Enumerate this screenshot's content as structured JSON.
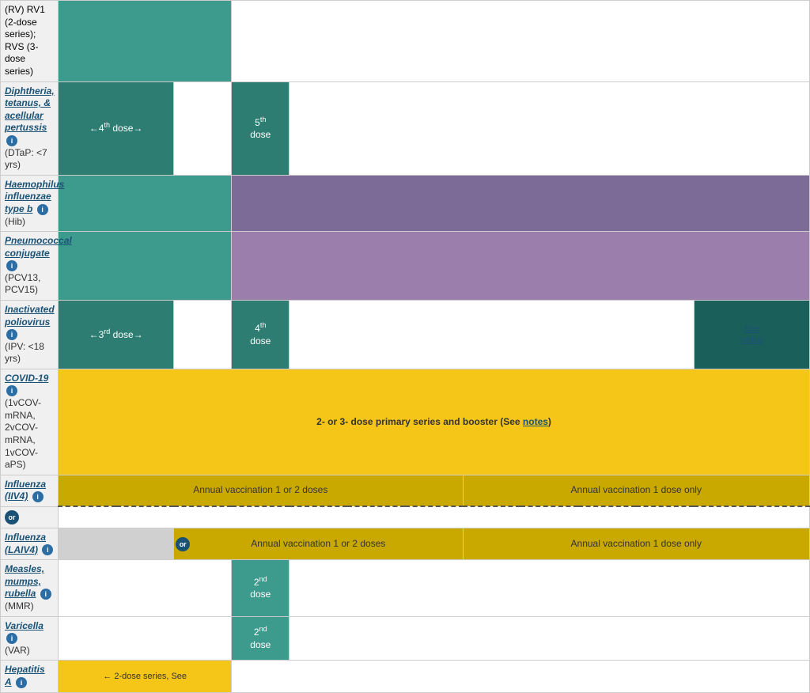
{
  "rows": [
    {
      "id": "rv",
      "vaccine_name": "(RV) RV1 (2-dose series); RVS (3-dose series)",
      "vaccine_link": false,
      "info": false,
      "sub": "",
      "type": "header-continuation"
    },
    {
      "id": "dtap",
      "vaccine_name": "Diphtheria, tetanus, & acellular pertussis",
      "vaccine_link": true,
      "info": true,
      "sub": "(DTaP: <7 yrs)",
      "dose_label_1": "←4th dose→",
      "dose_label_2": "5th dose"
    },
    {
      "id": "hib",
      "vaccine_name": "Haemophilus influenzae type b",
      "vaccine_link": true,
      "info": true,
      "sub": "(Hib)"
    },
    {
      "id": "pcv",
      "vaccine_name": "Pneumococcal conjugate",
      "vaccine_link": true,
      "info": true,
      "sub": "(PCV13, PCV15)"
    },
    {
      "id": "ipv",
      "vaccine_name": "Inactivated poliovirus",
      "vaccine_link": true,
      "info": true,
      "sub": "(IPV: <18 yrs)",
      "dose_label_1": "←3rd dose→",
      "dose_label_2": "4th dose",
      "notes": "See notes"
    },
    {
      "id": "covid",
      "vaccine_name": "COVID-19",
      "vaccine_link": true,
      "info": true,
      "sub": "(1vCOV-mRNA, 2vCOV-mRNA, 1vCOV-aPS)",
      "span_text": "2- or 3- dose primary series and booster (See notes)"
    },
    {
      "id": "influenza-iiv4",
      "vaccine_name": "Influenza (IIV4)",
      "vaccine_link": true,
      "info": true,
      "sub": "",
      "dose_early": "Annual vaccination 1 or 2 doses",
      "dose_late": "Annual vaccination 1 dose only"
    },
    {
      "id": "influenza-laiv4",
      "vaccine_name": "Influenza (LAIV4)",
      "vaccine_link": true,
      "info": true,
      "sub": "",
      "dose_early": "Annual vaccination 1 or 2 doses",
      "dose_late": "Annual vaccination 1 dose only"
    },
    {
      "id": "mmr",
      "vaccine_name": "Measles, mumps, rubella",
      "vaccine_link": true,
      "info": true,
      "sub": "(MMR)",
      "dose_label": "2nd dose"
    },
    {
      "id": "varicella",
      "vaccine_name": "Varicella",
      "vaccine_link": true,
      "info": true,
      "sub": "(VAR)",
      "dose_label": "2nd dose"
    },
    {
      "id": "hepa",
      "vaccine_name": "Hepatitis A",
      "vaccine_link": true,
      "info": true,
      "sub": "",
      "dose_label": "← 2-dose series, See"
    }
  ],
  "labels": {
    "notes": "notes",
    "or": "or",
    "see_notes": "notes"
  }
}
